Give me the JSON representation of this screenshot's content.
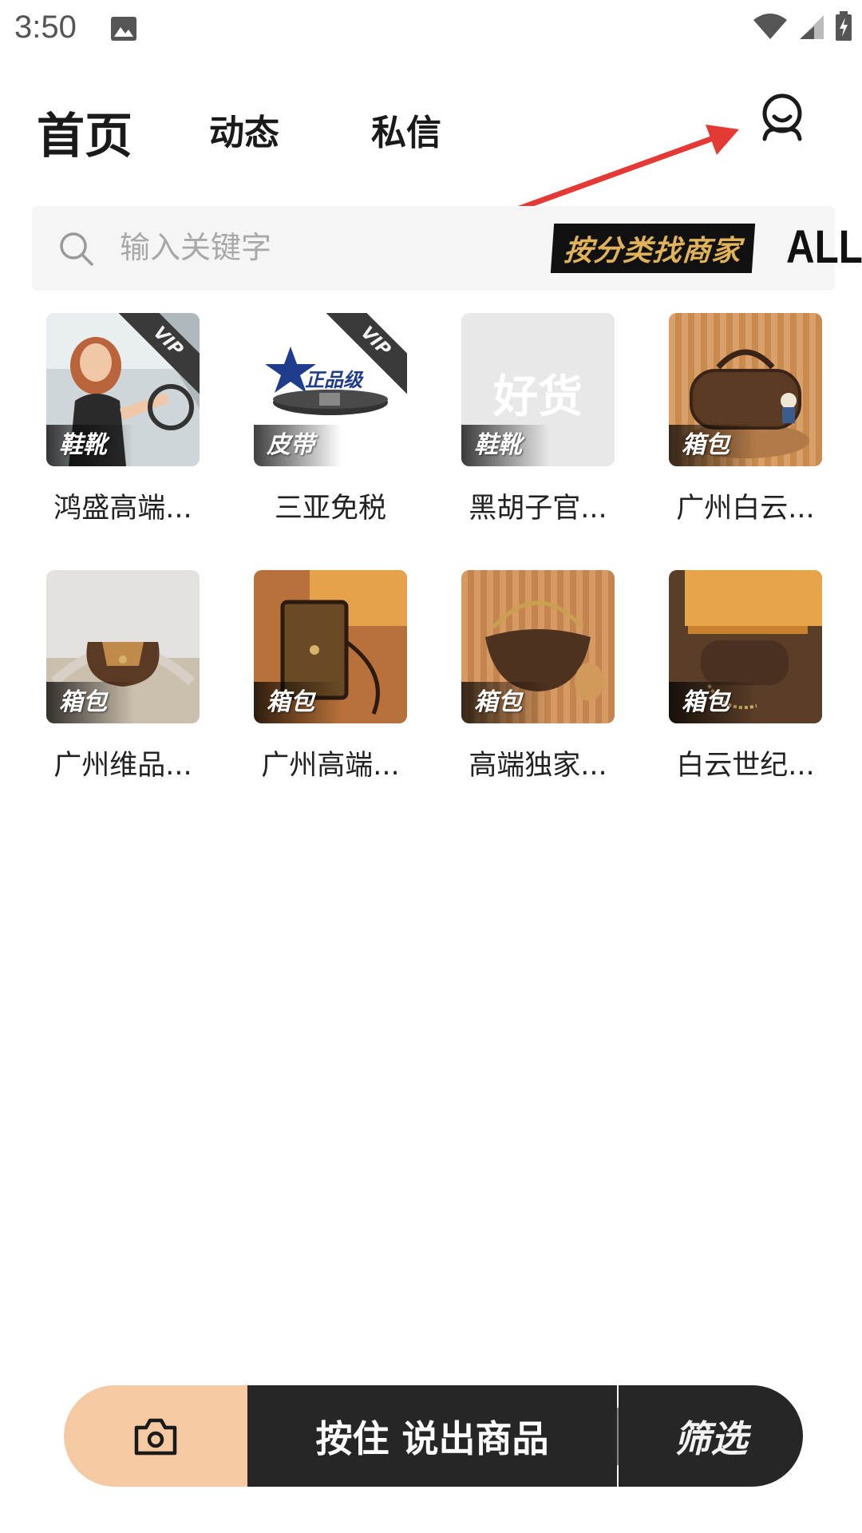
{
  "status_bar": {
    "time": "3:50"
  },
  "tabs": [
    {
      "label": "首页"
    },
    {
      "label": "动态"
    },
    {
      "label": "私信"
    }
  ],
  "search": {
    "placeholder": "输入关键字",
    "category_button": "按分类找商家",
    "all_button": "ALL"
  },
  "items": [
    {
      "name": "鸿盛高端...",
      "tag": "鞋靴",
      "vip": "VIP",
      "thumb": "photo-woman-in-car"
    },
    {
      "name": "三亚免税",
      "tag": "皮带",
      "vip": "VIP",
      "thumb": "belt-authentic-badge",
      "badge_text": "正品级"
    },
    {
      "name": "黑胡子官...",
      "tag": "鞋靴",
      "thumb": "placeholder",
      "placeholder_text": "好货"
    },
    {
      "name": "广州白云...",
      "tag": "箱包",
      "thumb": "monogram-duffle-bag"
    },
    {
      "name": "广州维品...",
      "tag": "箱包",
      "thumb": "monogram-crossbody-bag"
    },
    {
      "name": "广州高端...",
      "tag": "箱包",
      "thumb": "monogram-trunk-bag"
    },
    {
      "name": "高端独家...",
      "tag": "箱包",
      "thumb": "monogram-hobo-bag"
    },
    {
      "name": "白云世纪...",
      "tag": "箱包",
      "thumb": "monogram-pochette"
    }
  ],
  "bottom_bar": {
    "camera_icon": "camera-icon",
    "voice_label": "按住 说出商品",
    "filter_label": "筛选"
  },
  "colors": {
    "camera_bg": "#f5c9a2",
    "bar_bg": "#262626",
    "category_text": "#e0b25a",
    "arrow": "#e53935"
  }
}
